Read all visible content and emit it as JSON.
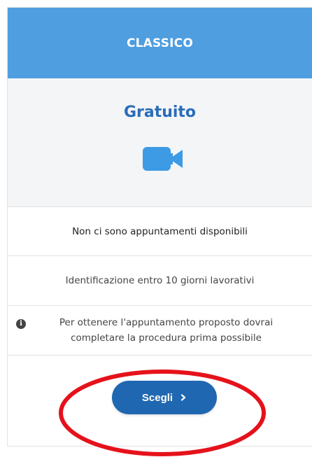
{
  "plan": {
    "header_title": "CLASSICO",
    "price_label": "Gratuito",
    "icon": "video-camera-icon",
    "availability_text": "Non ci sono appuntamenti disponibili",
    "identification_text": "Identificazione entro 10 giorni lavorativi",
    "notice_text": "Per ottenere l'appuntamento proposto dovrai completare la procedura prima possibile",
    "choose_button_label": "Scegli"
  },
  "colors": {
    "header_bg": "#4e9ee0",
    "price_text": "#2a6db8",
    "button_bg": "#1f67b1",
    "highlight": "#e5121b"
  }
}
